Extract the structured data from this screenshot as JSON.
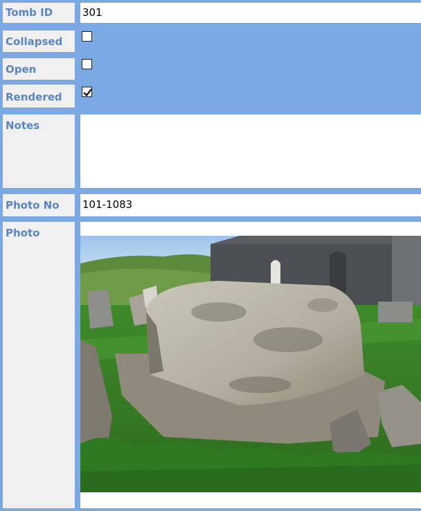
{
  "form": {
    "fields": {
      "tomb_id": {
        "label": "Tomb ID",
        "value": "301"
      },
      "collapsed": {
        "label": "Collapsed",
        "checked": false
      },
      "open": {
        "label": "Open",
        "checked": false
      },
      "rendered": {
        "label": "Rendered",
        "checked": true
      },
      "notes": {
        "label": "Notes",
        "value": ""
      },
      "photo_no": {
        "label": "Photo No",
        "value": "101-1083"
      },
      "photo": {
        "label": "Photo"
      }
    }
  },
  "colors": {
    "frame_blue": "#7aa9e3",
    "label_bg": "#f0f0f0",
    "label_text": "#5b86c3"
  }
}
